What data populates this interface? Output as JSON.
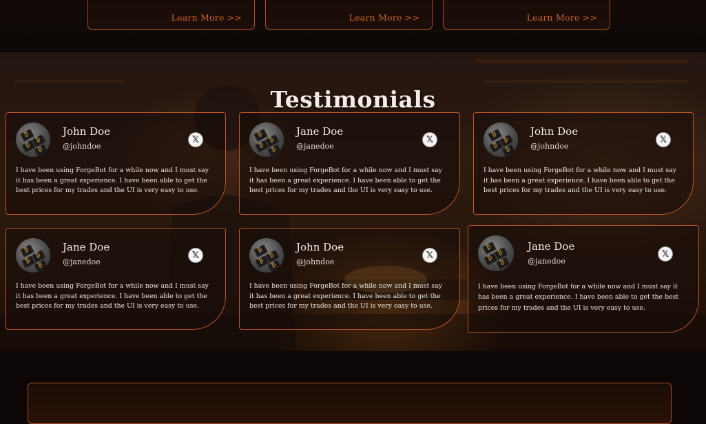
{
  "feature_cards": [
    {
      "link": "Learn More >>"
    },
    {
      "link": "Learn More >>"
    },
    {
      "link": "Learn More >>"
    }
  ],
  "testimonials": {
    "title": "Testimonials",
    "items": [
      {
        "name": "John Doe",
        "handle": "@johndoe",
        "text": "I have been using ForgeBot for a while now and I must say it has been a great experience. I have been able to get the best prices for my trades and the UI is very easy to use.",
        "icon": "x-icon"
      },
      {
        "name": "Jane Doe",
        "handle": "@janedoe",
        "text": "I have been using ForgeBot for a while now and I must say it has been a great experience. I have been able to get the best prices for my trades and the UI is very easy to use.",
        "icon": "x-icon"
      },
      {
        "name": "John Doe",
        "handle": "@johndoe",
        "text": "I have been using ForgeBot for a while now and I must say it has been a great experience. I have been able to get the best prices for my trades and the UI is very easy to use.",
        "icon": "x-icon"
      },
      {
        "name": "Jane Doe",
        "handle": "@janedoe",
        "text": "I have been using ForgeBot for a while now and I must say it has been a great experience. I have been able to get the best prices for my trades and the UI is very easy to use.",
        "icon": "x-icon"
      },
      {
        "name": "John Doe",
        "handle": "@johndoe",
        "text": "I have been using ForgeBot for a while now and I must say it has been a great experience. I have been able to get the best prices for my trades and the UI is very easy to use.",
        "icon": "x-icon"
      },
      {
        "name": "Jane Doe",
        "handle": "@janedoe",
        "text": "I have been using ForgeBot for a while now and I must say it has been a great experience. I have been able to get the best prices for my trades and the UI is very easy to use.",
        "icon": "x-icon"
      }
    ]
  },
  "colors": {
    "accent": "#c4551c",
    "link": "#d2641f",
    "background": "#0c0706"
  }
}
